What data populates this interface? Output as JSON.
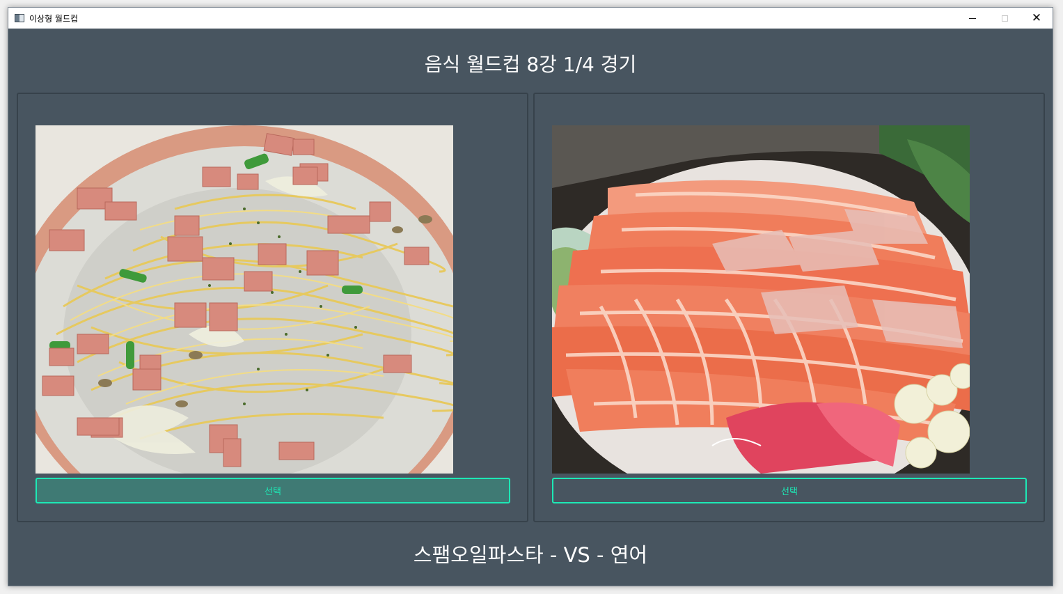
{
  "window": {
    "title": "이상형 월드컵",
    "controls": {
      "minimize": "minimize-icon",
      "maximize": "maximize-icon",
      "close": "close-icon"
    }
  },
  "heading": "음식 월드컵 8강 1/4 경기",
  "candidates": [
    {
      "image": "spam-oil-pasta-photo",
      "select_label": "선택"
    },
    {
      "image": "salmon-photo",
      "select_label": "선택"
    }
  ],
  "matchup": "스팸오일파스타 - VS - 연어",
  "colors": {
    "background": "#485560",
    "accent": "#1de9b6",
    "button_fill_left": "#3f7a74"
  }
}
